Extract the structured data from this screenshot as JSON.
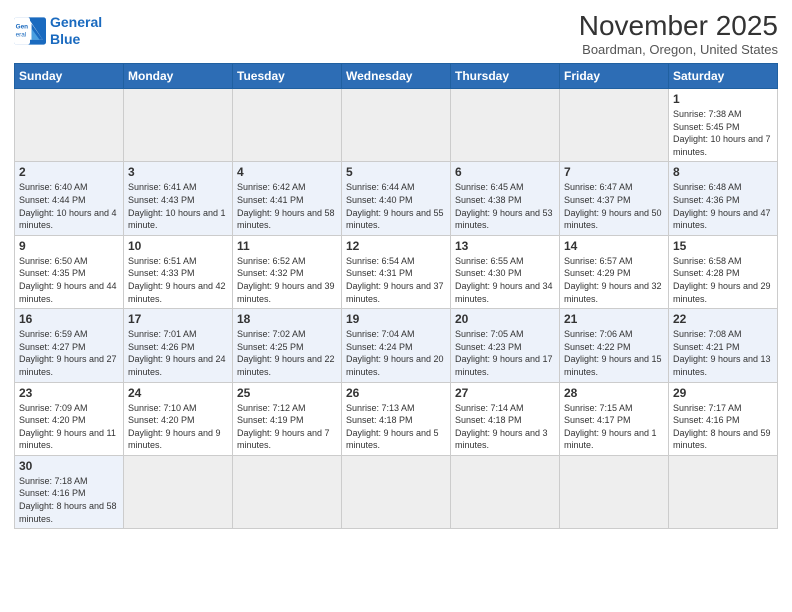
{
  "header": {
    "logo_line1": "General",
    "logo_line2": "Blue",
    "month": "November 2025",
    "location": "Boardman, Oregon, United States"
  },
  "weekdays": [
    "Sunday",
    "Monday",
    "Tuesday",
    "Wednesday",
    "Thursday",
    "Friday",
    "Saturday"
  ],
  "weeks": [
    [
      {
        "day": "",
        "info": ""
      },
      {
        "day": "",
        "info": ""
      },
      {
        "day": "",
        "info": ""
      },
      {
        "day": "",
        "info": ""
      },
      {
        "day": "",
        "info": ""
      },
      {
        "day": "",
        "info": ""
      },
      {
        "day": "1",
        "info": "Sunrise: 7:38 AM\nSunset: 5:45 PM\nDaylight: 10 hours\nand 7 minutes."
      }
    ],
    [
      {
        "day": "2",
        "info": "Sunrise: 6:40 AM\nSunset: 4:44 PM\nDaylight: 10 hours\nand 4 minutes."
      },
      {
        "day": "3",
        "info": "Sunrise: 6:41 AM\nSunset: 4:43 PM\nDaylight: 10 hours\nand 1 minute."
      },
      {
        "day": "4",
        "info": "Sunrise: 6:42 AM\nSunset: 4:41 PM\nDaylight: 9 hours\nand 58 minutes."
      },
      {
        "day": "5",
        "info": "Sunrise: 6:44 AM\nSunset: 4:40 PM\nDaylight: 9 hours\nand 55 minutes."
      },
      {
        "day": "6",
        "info": "Sunrise: 6:45 AM\nSunset: 4:38 PM\nDaylight: 9 hours\nand 53 minutes."
      },
      {
        "day": "7",
        "info": "Sunrise: 6:47 AM\nSunset: 4:37 PM\nDaylight: 9 hours\nand 50 minutes."
      },
      {
        "day": "8",
        "info": "Sunrise: 6:48 AM\nSunset: 4:36 PM\nDaylight: 9 hours\nand 47 minutes."
      }
    ],
    [
      {
        "day": "9",
        "info": "Sunrise: 6:50 AM\nSunset: 4:35 PM\nDaylight: 9 hours\nand 44 minutes."
      },
      {
        "day": "10",
        "info": "Sunrise: 6:51 AM\nSunset: 4:33 PM\nDaylight: 9 hours\nand 42 minutes."
      },
      {
        "day": "11",
        "info": "Sunrise: 6:52 AM\nSunset: 4:32 PM\nDaylight: 9 hours\nand 39 minutes."
      },
      {
        "day": "12",
        "info": "Sunrise: 6:54 AM\nSunset: 4:31 PM\nDaylight: 9 hours\nand 37 minutes."
      },
      {
        "day": "13",
        "info": "Sunrise: 6:55 AM\nSunset: 4:30 PM\nDaylight: 9 hours\nand 34 minutes."
      },
      {
        "day": "14",
        "info": "Sunrise: 6:57 AM\nSunset: 4:29 PM\nDaylight: 9 hours\nand 32 minutes."
      },
      {
        "day": "15",
        "info": "Sunrise: 6:58 AM\nSunset: 4:28 PM\nDaylight: 9 hours\nand 29 minutes."
      }
    ],
    [
      {
        "day": "16",
        "info": "Sunrise: 6:59 AM\nSunset: 4:27 PM\nDaylight: 9 hours\nand 27 minutes."
      },
      {
        "day": "17",
        "info": "Sunrise: 7:01 AM\nSunset: 4:26 PM\nDaylight: 9 hours\nand 24 minutes."
      },
      {
        "day": "18",
        "info": "Sunrise: 7:02 AM\nSunset: 4:25 PM\nDaylight: 9 hours\nand 22 minutes."
      },
      {
        "day": "19",
        "info": "Sunrise: 7:04 AM\nSunset: 4:24 PM\nDaylight: 9 hours\nand 20 minutes."
      },
      {
        "day": "20",
        "info": "Sunrise: 7:05 AM\nSunset: 4:23 PM\nDaylight: 9 hours\nand 17 minutes."
      },
      {
        "day": "21",
        "info": "Sunrise: 7:06 AM\nSunset: 4:22 PM\nDaylight: 9 hours\nand 15 minutes."
      },
      {
        "day": "22",
        "info": "Sunrise: 7:08 AM\nSunset: 4:21 PM\nDaylight: 9 hours\nand 13 minutes."
      }
    ],
    [
      {
        "day": "23",
        "info": "Sunrise: 7:09 AM\nSunset: 4:20 PM\nDaylight: 9 hours\nand 11 minutes."
      },
      {
        "day": "24",
        "info": "Sunrise: 7:10 AM\nSunset: 4:20 PM\nDaylight: 9 hours\nand 9 minutes."
      },
      {
        "day": "25",
        "info": "Sunrise: 7:12 AM\nSunset: 4:19 PM\nDaylight: 9 hours\nand 7 minutes."
      },
      {
        "day": "26",
        "info": "Sunrise: 7:13 AM\nSunset: 4:18 PM\nDaylight: 9 hours\nand 5 minutes."
      },
      {
        "day": "27",
        "info": "Sunrise: 7:14 AM\nSunset: 4:18 PM\nDaylight: 9 hours\nand 3 minutes."
      },
      {
        "day": "28",
        "info": "Sunrise: 7:15 AM\nSunset: 4:17 PM\nDaylight: 9 hours\nand 1 minute."
      },
      {
        "day": "29",
        "info": "Sunrise: 7:17 AM\nSunset: 4:16 PM\nDaylight: 8 hours\nand 59 minutes."
      }
    ],
    [
      {
        "day": "30",
        "info": "Sunrise: 7:18 AM\nSunset: 4:16 PM\nDaylight: 8 hours\nand 58 minutes."
      },
      {
        "day": "",
        "info": ""
      },
      {
        "day": "",
        "info": ""
      },
      {
        "day": "",
        "info": ""
      },
      {
        "day": "",
        "info": ""
      },
      {
        "day": "",
        "info": ""
      },
      {
        "day": "",
        "info": ""
      }
    ]
  ]
}
